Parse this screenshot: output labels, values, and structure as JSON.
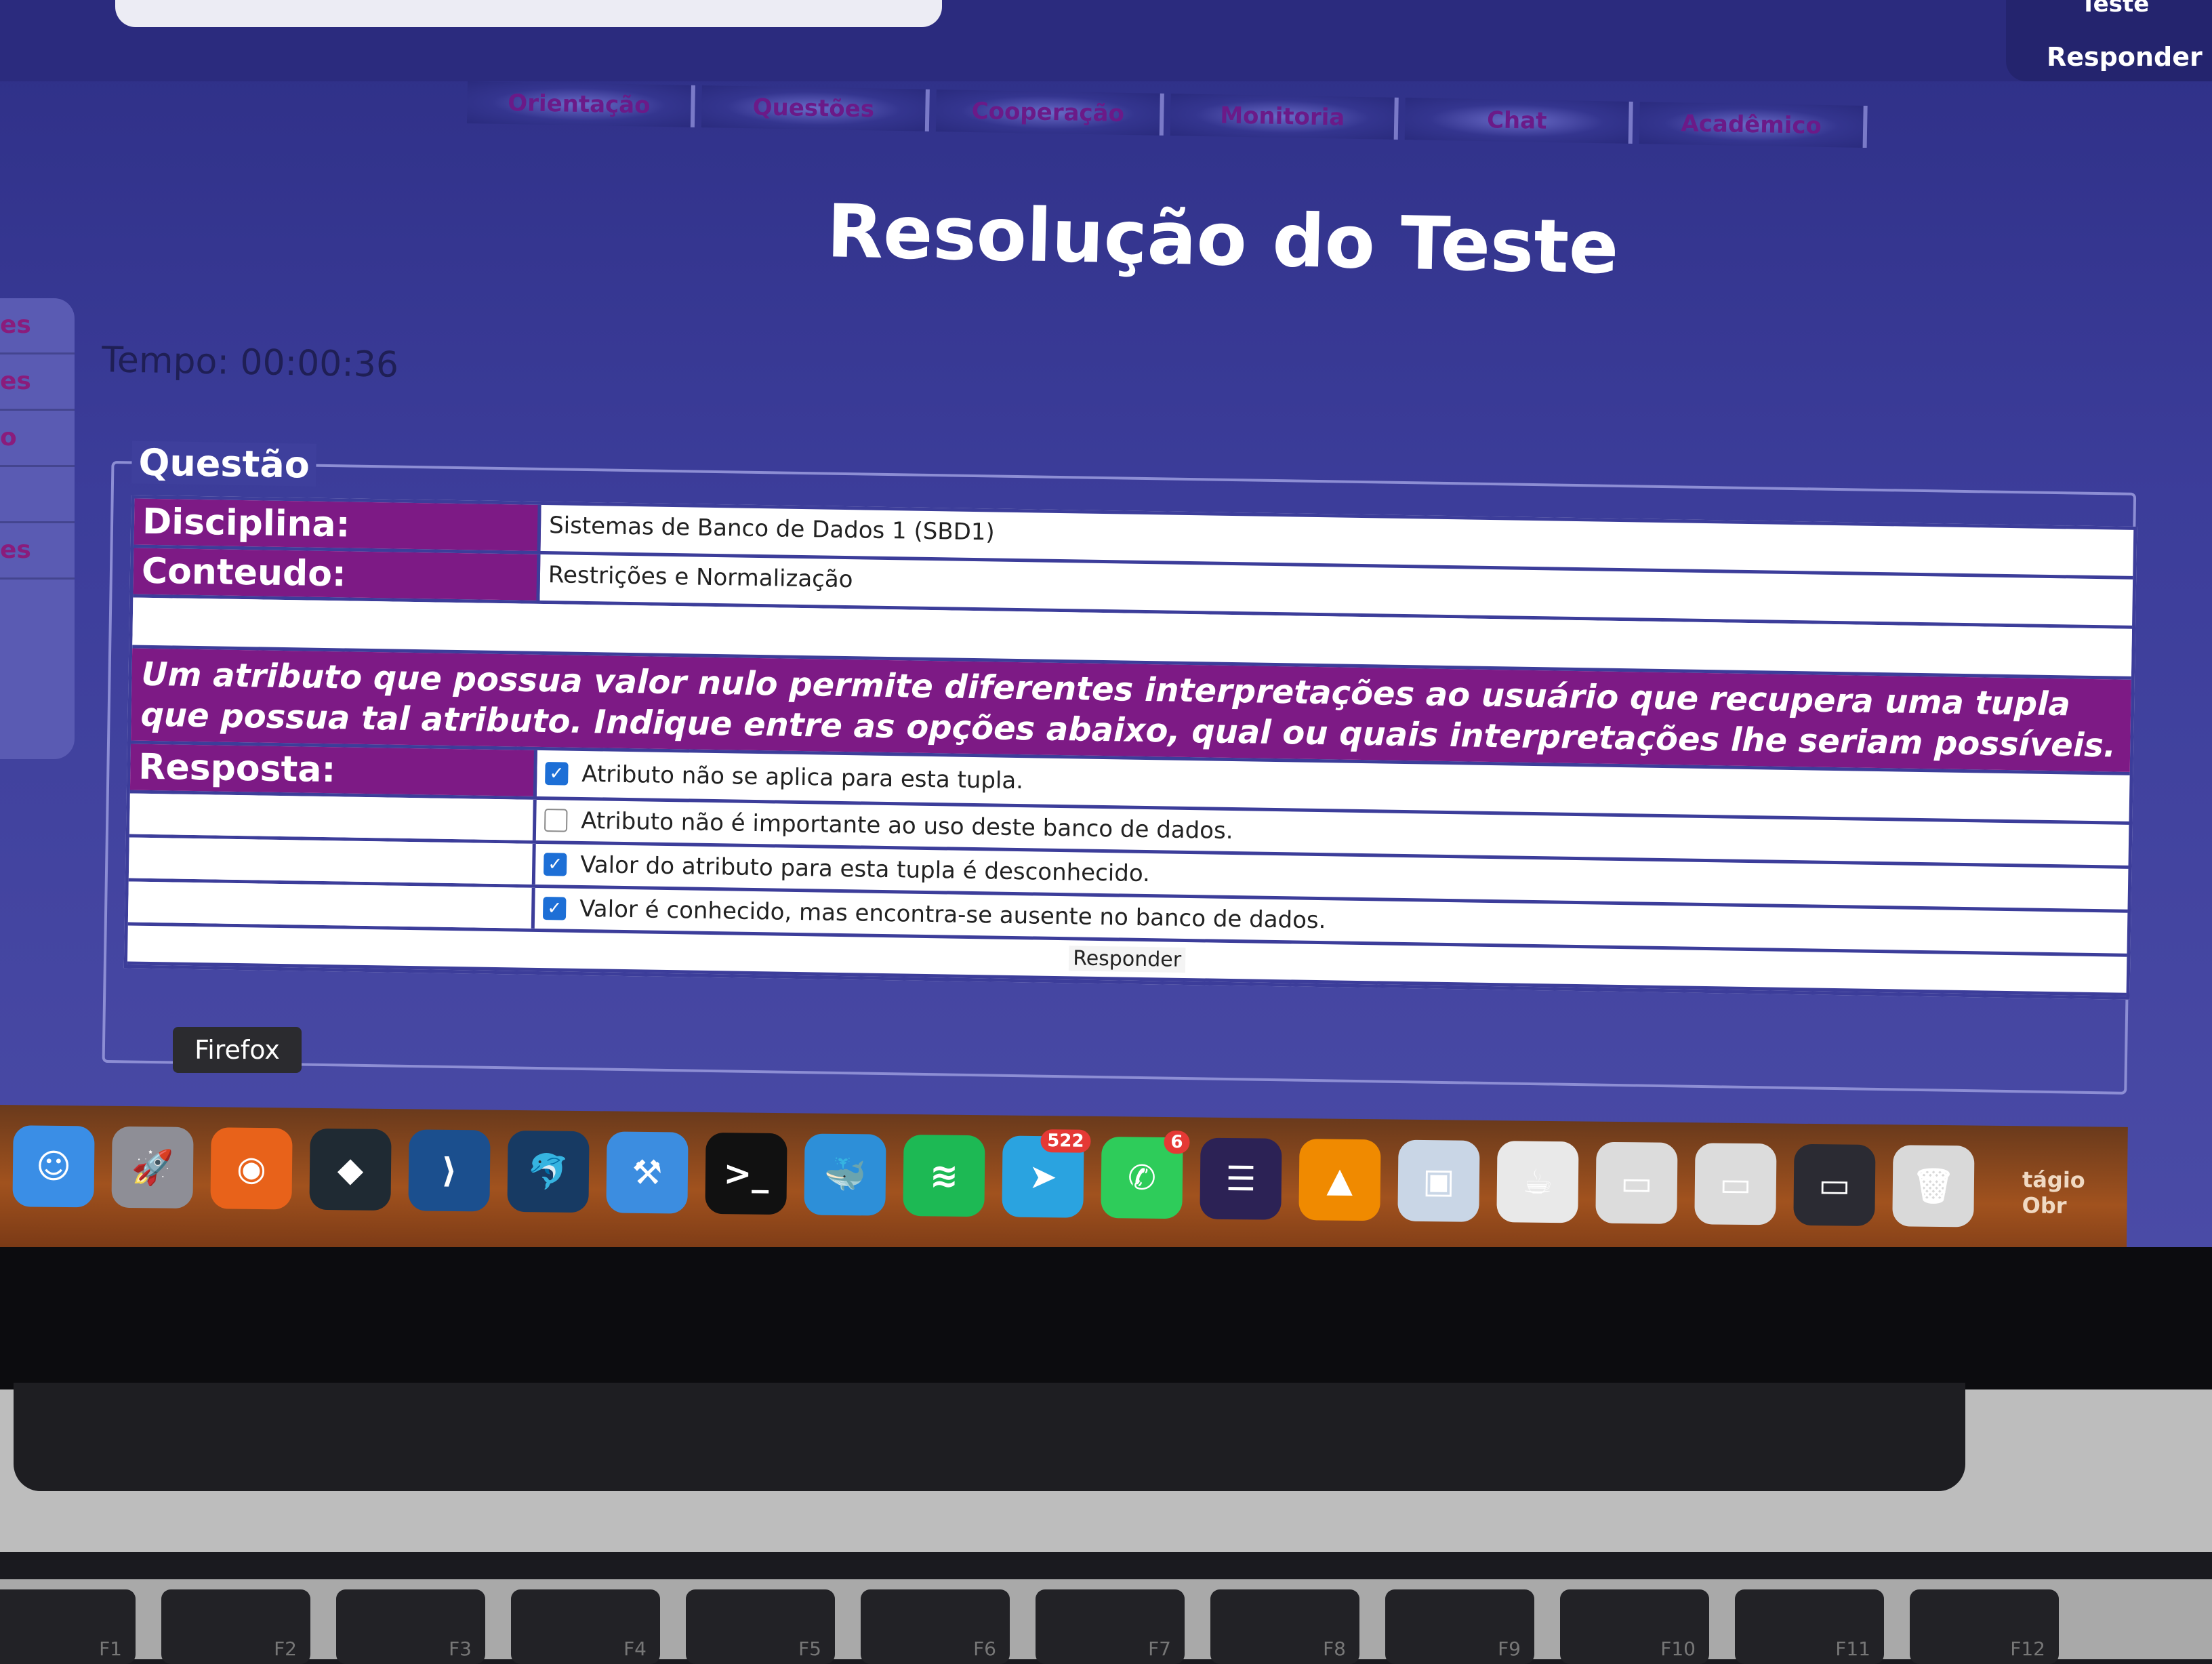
{
  "top": {
    "teste_label": "Teste",
    "responder_label": "Responder"
  },
  "nav": {
    "tabs": [
      "Orientação",
      "Questões",
      "Cooperação",
      "Monitoria",
      "Chat",
      "Acadêmico"
    ]
  },
  "sidebar": {
    "items": [
      "es",
      "es",
      "o",
      "",
      "es"
    ]
  },
  "page": {
    "title": "Resolução do Teste",
    "timer": "Tempo: 00:00:36"
  },
  "question": {
    "legend": "Questão",
    "discipline_label": "Disciplina:",
    "discipline_value": "Sistemas de Banco de Dados 1 (SBD1)",
    "content_label": "Conteudo:",
    "content_value": "Restrições e Normalização",
    "statement": "Um atributo que possua valor nulo permite diferentes interpretações ao usuário que recupera uma tupla que possua tal atributo. Indique entre as opções abaixo, qual ou quais interpretações lhe seriam possíveis.",
    "answer_label": "Resposta:",
    "options": [
      {
        "text": "Atributo não se aplica para esta tupla.",
        "checked": true
      },
      {
        "text": "Atributo não é importante ao uso deste banco de dados.",
        "checked": false
      },
      {
        "text": "Valor do atributo para esta tupla é desconhecido.",
        "checked": true
      },
      {
        "text": "Valor é conhecido, mas encontra-se ausente no banco de dados.",
        "checked": true
      }
    ],
    "submit_label": "Responder"
  },
  "tooltip": {
    "text": "Firefox"
  },
  "dock": {
    "apps": [
      {
        "name": "finder-icon",
        "color": "#3a8ee6",
        "glyph": "☺"
      },
      {
        "name": "launchpad-icon",
        "color": "#8e8e96",
        "glyph": "🚀"
      },
      {
        "name": "firefox-icon",
        "color": "#e8621a",
        "glyph": "◉"
      },
      {
        "name": "filmora-icon",
        "color": "#1f2a33",
        "glyph": "◆"
      },
      {
        "name": "vscode-icon",
        "color": "#1b4f8e",
        "glyph": "⟩"
      },
      {
        "name": "mysql-workbench-icon",
        "color": "#173a63",
        "glyph": "🐬"
      },
      {
        "name": "xcode-icon",
        "color": "#3c8de0",
        "glyph": "⚒"
      },
      {
        "name": "terminal-icon",
        "color": "#111111",
        "glyph": ">_"
      },
      {
        "name": "docker-icon",
        "color": "#2d8fd8",
        "glyph": "🐳"
      },
      {
        "name": "spotify-icon",
        "color": "#1db954",
        "glyph": "≋"
      },
      {
        "name": "telegram-icon",
        "color": "#2aa3e0",
        "glyph": "➤",
        "badge": "522"
      },
      {
        "name": "whatsapp-icon",
        "color": "#2ecc5a",
        "glyph": "✆",
        "badge": "6"
      },
      {
        "name": "eclipse-icon",
        "color": "#2c2255",
        "glyph": "☰"
      },
      {
        "name": "vlc-icon",
        "color": "#f08a00",
        "glyph": "▲"
      },
      {
        "name": "preview-icon",
        "color": "#c9d6e6",
        "glyph": "▣"
      },
      {
        "name": "java-icon",
        "color": "#e9e9e9",
        "glyph": "☕"
      },
      {
        "name": "minimized-window-icon",
        "color": "#dcdcdc",
        "glyph": "▭"
      },
      {
        "name": "minimized-window-icon",
        "color": "#dcdcdc",
        "glyph": "▭"
      },
      {
        "name": "minimized-window-icon",
        "color": "#2b2b33",
        "glyph": "▭"
      },
      {
        "name": "trash-icon",
        "color": "#d9d9d9",
        "glyph": "🗑"
      }
    ],
    "stack_label": "tágio Obr"
  },
  "keyboard": {
    "keys": [
      "F1",
      "F2",
      "F3",
      "F4",
      "F5",
      "F6",
      "F7",
      "F8",
      "F9",
      "F10",
      "F11",
      "F12"
    ]
  }
}
